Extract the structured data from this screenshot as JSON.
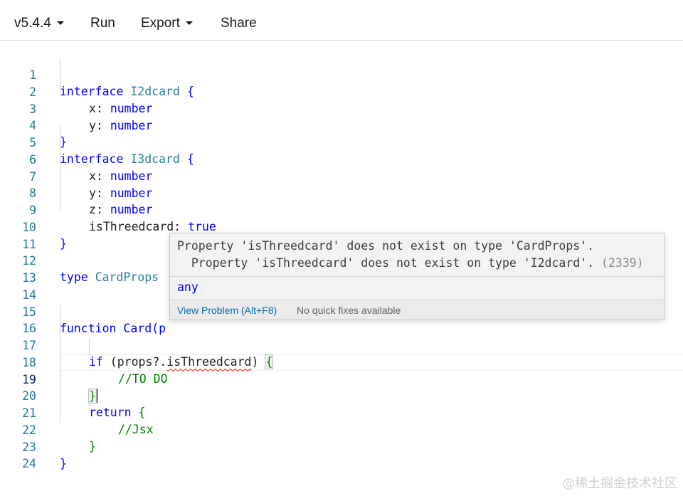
{
  "toolbar": {
    "version_label": "v5.4.4",
    "run_label": "Run",
    "export_label": "Export",
    "share_label": "Share"
  },
  "editor": {
    "line_numbers": [
      "1",
      "2",
      "3",
      "4",
      "5",
      "6",
      "7",
      "8",
      "9",
      "10",
      "11",
      "12",
      "13",
      "14",
      "15",
      "16",
      "17",
      "18",
      "19",
      "20",
      "21",
      "22",
      "23",
      "24"
    ],
    "active_line": "19",
    "tokens": {
      "interface": "interface",
      "i2dcard": "I2dcard",
      "i3dcard": "I3dcard",
      "open_brace": " {",
      "close_brace": "}",
      "x": "x",
      "y": "y",
      "z": "z",
      "colon": ": ",
      "number": "number",
      "is_threedcard": "isThreedcard",
      "true": "true",
      "type_kw": "type",
      "card_props": "CardProps",
      "function_kw": "function",
      "card_fn_partial": "Card(p",
      "if_kw": "if",
      "props_open": " (props?.",
      "props_close": ")",
      "brace_space": " ",
      "todo_comment": "//TO DO",
      "return_kw": "return",
      "jsx_comment": "//Jsx"
    }
  },
  "hover": {
    "message_line1": "Property 'isThreedcard' does not exist on type 'CardProps'.",
    "message_line2": "  Property 'isThreedcard' does not exist on type 'I2dcard'.",
    "error_code": "(2339)",
    "type_text": "any",
    "view_problem": "View Problem (Alt+F8)",
    "no_quick_fixes": "No quick fixes available"
  },
  "watermark": "@稀土掘金技术社区"
}
